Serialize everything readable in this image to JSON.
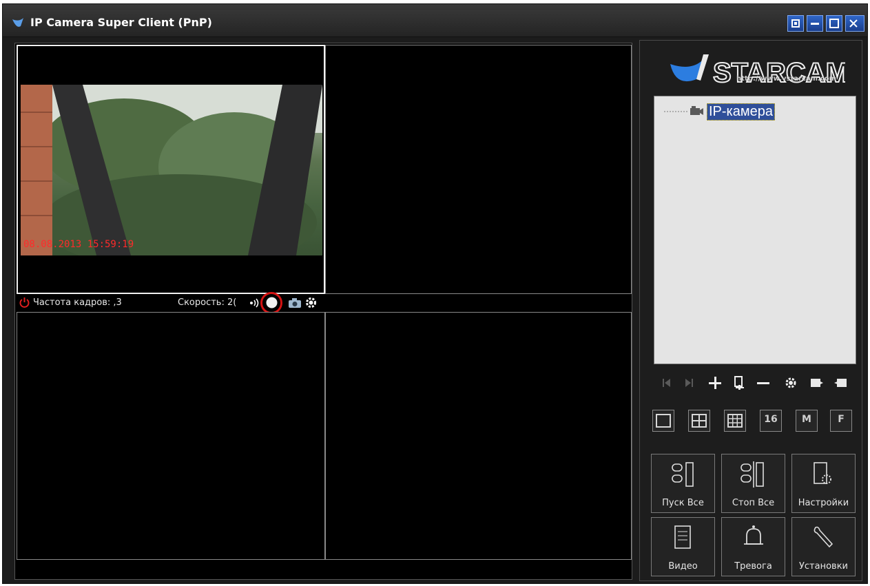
{
  "window": {
    "title": "IP Camera Super Client (PnP)"
  },
  "video": {
    "timestamp": "08.08.2013 15:59:19"
  },
  "status_bar": {
    "frame_rate": "Частота кадров: ,3",
    "speed": "Скорость: 2("
  },
  "brand": {
    "url": "http://www.vstarcam.com"
  },
  "tree": {
    "camera_label": "IP-камера"
  },
  "layout_buttons": [
    "16",
    "M",
    "F"
  ],
  "actions": {
    "start_all": "Пуск Все",
    "stop_all": "Стоп Все",
    "settings": "Настройки",
    "video": "Видео",
    "alarm": "Тревога",
    "setup": "Установки"
  },
  "icons": [
    "app-icon",
    "restore-icon",
    "minimize-icon",
    "maximize-icon",
    "close-icon",
    "power-icon",
    "audio-icon",
    "record-icon",
    "snapshot-icon",
    "gear-icon",
    "prev-icon",
    "next-icon",
    "add-icon",
    "add-device-icon",
    "remove-icon",
    "settings-icon",
    "export-icon",
    "import-icon",
    "camera-icon",
    "bell-icon",
    "wrench-icon"
  ],
  "colors": {
    "accent_red": "#d41313",
    "timestamp_red": "#ff2a2a",
    "title_blue": "#2f66c8",
    "selection_blue": "#2f4f9a"
  }
}
